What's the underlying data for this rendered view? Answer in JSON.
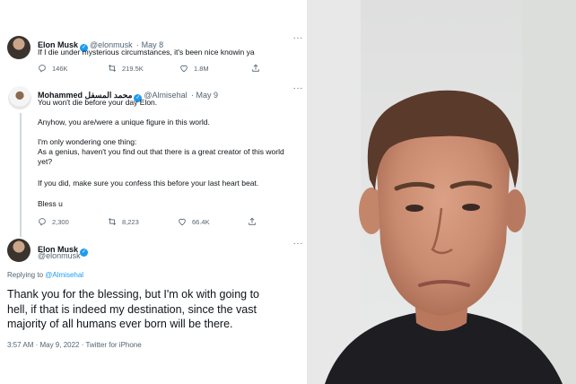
{
  "tweet1": {
    "name": "Elon Musk",
    "handle": "@elonmusk",
    "date": "· May 8",
    "text": "If I die under mysterious circumstances, it's been nice knowin ya",
    "replies": "146K",
    "retweets": "219.5K",
    "likes": "1.8M"
  },
  "tweet2": {
    "name": "Mohammed محمد المسفل",
    "handle": "@Almisehal",
    "date": "· May 9",
    "lines": [
      "You won't die before your day Elon.",
      "Anyhow, you are/were a unique figure in this world.",
      "I'm only wondering one thing:",
      "As a genius, haven't you find out that there is a great creator of this world",
      "yet?",
      "If you did, make sure you confess this before your last heart beat.",
      "Bless u"
    ],
    "replies": "2,300",
    "retweets": "8,223",
    "likes": "66.4K"
  },
  "tweet3": {
    "name": "Elon Musk",
    "handle": "@elonmusk",
    "replying_prefix": "Replying to",
    "replying_to": "@Almisehal",
    "lines": [
      "Thank you for the blessing, but I'm ok with going to",
      "hell, if that is indeed my destination, since the vast",
      "majority of all humans ever born will be there."
    ],
    "timestamp": "3:57 AM · May 9, 2022 · Twitter for iPhone"
  },
  "colors": {
    "accent": "#1d9bf0",
    "secondary_text": "#536471"
  }
}
